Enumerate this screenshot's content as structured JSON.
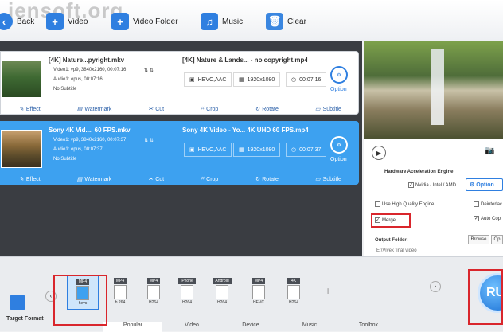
{
  "watermark": "jensoft.org",
  "toolbar": {
    "back": "Back",
    "video": "Video",
    "video_folder": "Video Folder",
    "music": "Music",
    "clear": "Clear"
  },
  "tasks": [
    {
      "src_name": "[4K] Nature...pyright.mkv",
      "video_meta": "Video1: vp9, 3840x2160, 00:07:16",
      "audio_meta": "Audio1: opus, 00:07:16",
      "subtitle_meta": "No Subtitle",
      "out_name": "[4K] Nature & Lands... - no copyright.mp4",
      "codec": "HEVC,AAC",
      "res": "1920x1080",
      "dur": "00:07:16",
      "option": "Option"
    },
    {
      "src_name": "Sony 4K Vid.... 60 FPS.mkv",
      "video_meta": "Video1: vp9, 3840x2160, 00:07:37",
      "audio_meta": "Audio1: opus, 00:07:37",
      "subtitle_meta": "No Subtitle",
      "out_name": "Sony 4K Video - Yo... 4K UHD 60 FPS.mp4",
      "codec": "HEVC,AAC",
      "res": "1920x1080",
      "dur": "00:07:37",
      "option": "Option"
    }
  ],
  "actions": {
    "effect": "Effect",
    "watermark": "Watermark",
    "cut": "Cut",
    "crop": "Crop",
    "rotate": "Rotate",
    "subtitle": "Subtitle"
  },
  "settings": {
    "hw_title": "Hardware Acceleration Engine:",
    "nvidia": "Nvidia / Intel / AMD",
    "option": "Option",
    "hq": "Use High Quality Engine",
    "deinterlace": "Deinterlac",
    "merge": "Merge",
    "auto_copy": "Auto Cop",
    "out_folder": "Output Folder:",
    "out_path": "E:\\Vivek final video",
    "browse": "Browse",
    "open": "Op"
  },
  "formats": [
    {
      "top": "MP4",
      "sub": "hevc"
    },
    {
      "top": "MP4",
      "sub": "h.264"
    },
    {
      "top": "MP4",
      "sub": "H264"
    },
    {
      "top": "iPhone",
      "sub": "H264"
    },
    {
      "top": "Android",
      "sub": "H264"
    },
    {
      "top": "MP4",
      "sub": "HEVC"
    },
    {
      "top": "4K",
      "sub": "H264"
    }
  ],
  "target_format": "Target Format",
  "tabs": [
    "Popular",
    "Video",
    "Device",
    "Music",
    "Toolbox"
  ],
  "run": "RU",
  "accent": "#2f7fe0",
  "selected_bg": "#3da1f0",
  "highlight": "#d9262c"
}
